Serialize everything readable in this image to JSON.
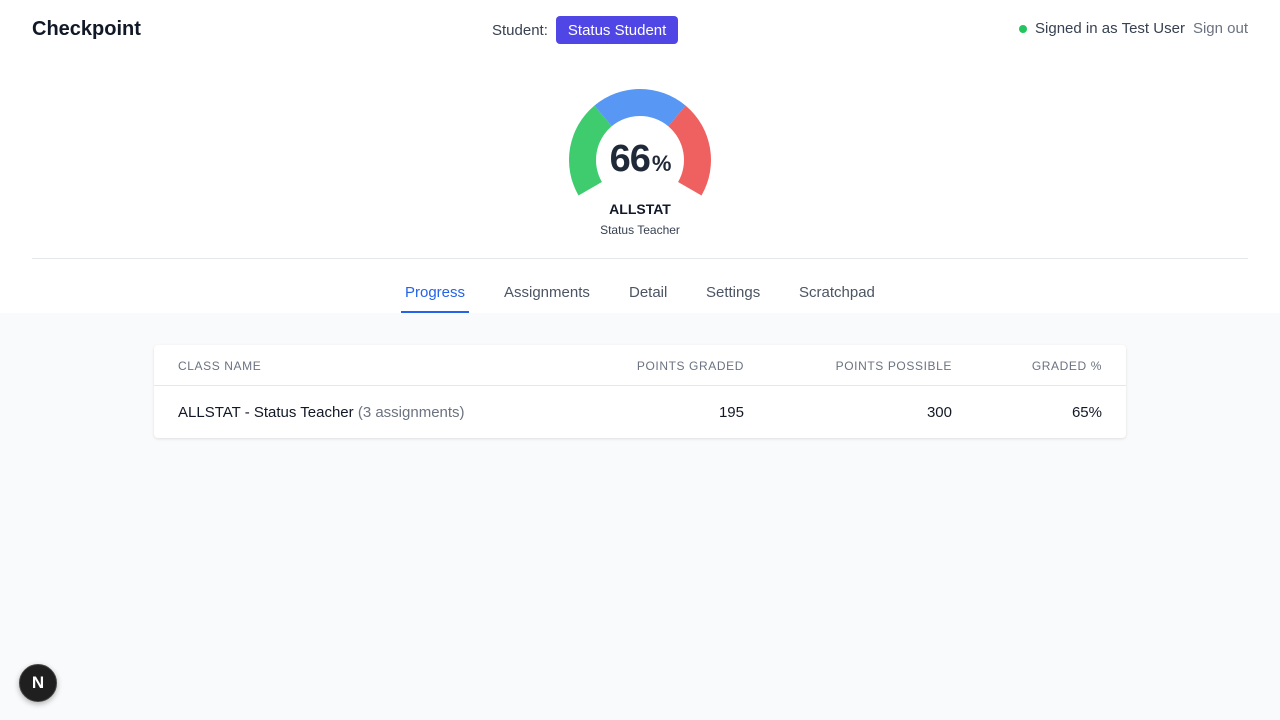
{
  "header": {
    "brand": "Checkpoint",
    "student_label": "Student:",
    "student_value": "Status Student",
    "signed_in_text": "Signed in as",
    "user_name": "Test User",
    "sign_out": "Sign out",
    "status_color": "#22c55e"
  },
  "gauge": {
    "value": 66,
    "unit": "%",
    "class_code": "ALLSTAT",
    "teacher": "Status Teacher",
    "colors": {
      "low": "#3fcc6f",
      "mid": "#5897f3",
      "high": "#ef6060"
    }
  },
  "tabs": [
    {
      "label": "Progress",
      "active": true
    },
    {
      "label": "Assignments",
      "active": false
    },
    {
      "label": "Detail",
      "active": false
    },
    {
      "label": "Settings",
      "active": false
    },
    {
      "label": "Scratchpad",
      "active": false
    }
  ],
  "table": {
    "headers": [
      "CLASS NAME",
      "POINTS GRADED",
      "POINTS POSSIBLE",
      "GRADED %"
    ],
    "rows": [
      {
        "class_name": "ALLSTAT - Status Teacher",
        "assignments_note": "(3 assignments)",
        "points_graded": "195",
        "points_possible": "300",
        "graded_pct": "65%"
      }
    ]
  },
  "dev_badge": {
    "letter": "N",
    "icon": "nextjs-logo-icon"
  }
}
